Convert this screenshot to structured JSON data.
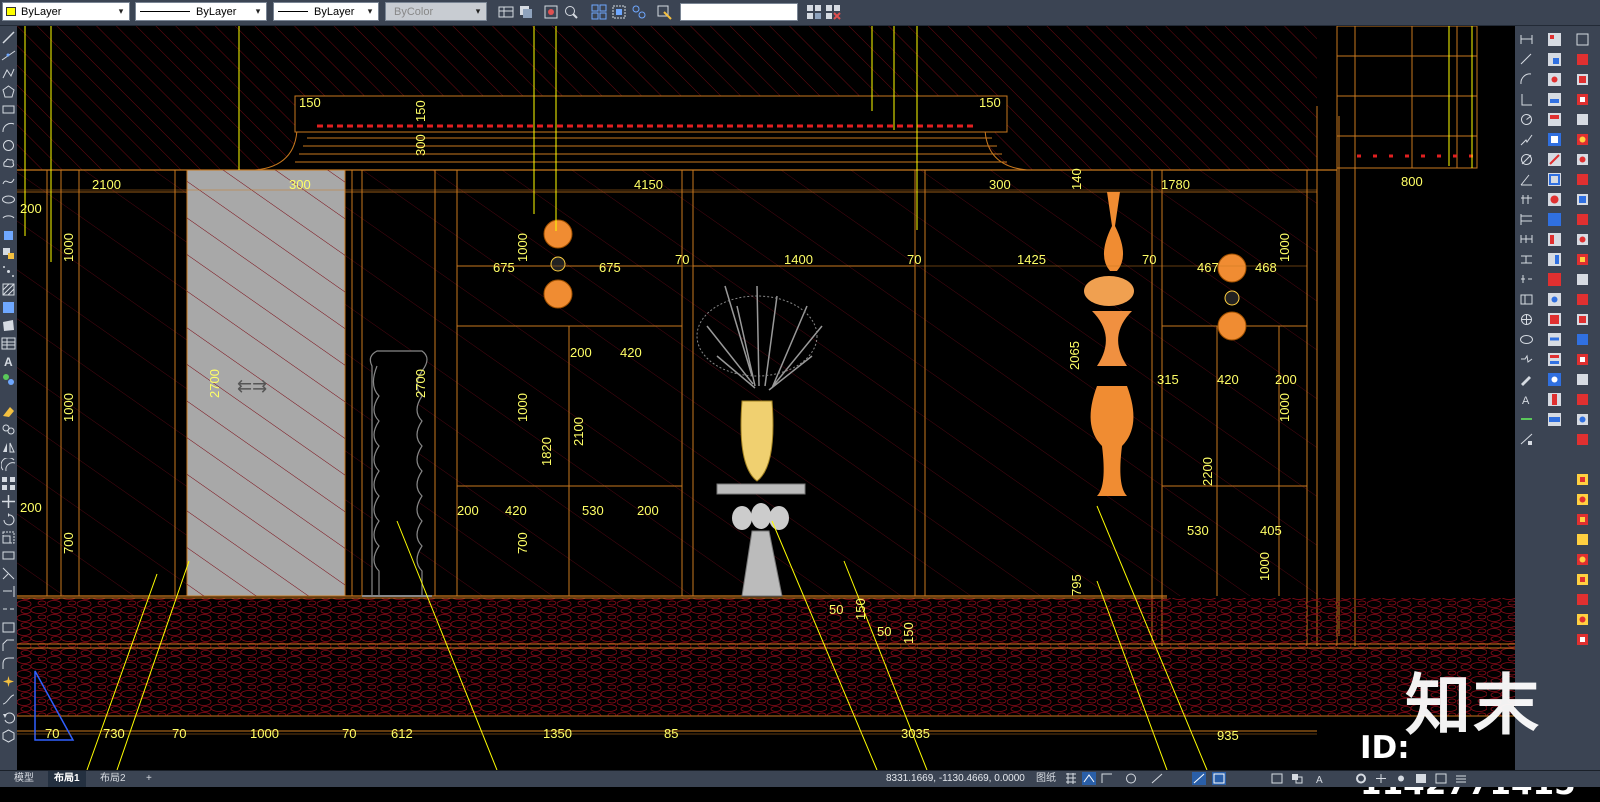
{
  "toolbar": {
    "color_dropdown": "ByLayer",
    "linetype_dropdown": "ByLayer",
    "lineweight_dropdown": "ByLayer",
    "plotstyle_dropdown": "ByColor",
    "search_value": ""
  },
  "drawing": {
    "dims": {
      "d150a": "150",
      "d150b": "150",
      "d300a": "300",
      "d150v": "150",
      "d2100": "2100",
      "d300b": "300",
      "d4150": "4150",
      "d300c": "300",
      "d140": "140",
      "d1780": "1780",
      "d800": "800",
      "d200a": "200",
      "d1000a": "1000",
      "d1000b": "1000",
      "d1000c": "1000",
      "d675a": "675",
      "d675b": "675",
      "d70a": "70",
      "d1400": "1400",
      "d70b": "70",
      "d1425": "1425",
      "d70c": "70",
      "d467": "467",
      "d468": "468",
      "d1000d": "1000",
      "d2700a": "2700",
      "d2700b": "2700",
      "d200b": "200",
      "d420a": "420",
      "d2065": "2065",
      "d315": "315",
      "d420b": "420",
      "d200c": "200",
      "d1000e": "1000",
      "d1000f": "1000",
      "d1820": "1820",
      "d2100b": "2100",
      "d1000g": "1000",
      "d2200": "2200",
      "d200d": "200",
      "d700a": "700",
      "d200e": "200",
      "d420c": "420",
      "d530a": "530",
      "d200f": "200",
      "d700b": "700",
      "d530b": "530",
      "d405": "405",
      "d1000h": "1000",
      "d795": "795",
      "d50a": "50",
      "d150c": "150",
      "d50b": "50",
      "d150d": "150",
      "d70d": "70",
      "d730": "730",
      "d70e": "70",
      "d1000i": "1000",
      "d70f": "70",
      "d612": "612",
      "d1350": "1350",
      "d85": "85",
      "d3035": "3035",
      "d935": "935"
    }
  },
  "watermark": {
    "logo_text": "知末",
    "id_text": "ID: 1142771415"
  },
  "status": {
    "tabs": [
      "模型",
      "布局1",
      "布局2"
    ],
    "add_tab": "+",
    "coordinates": "8331.1669, -1130.4669, 0.0000",
    "paper_label": "图纸"
  },
  "colors": {
    "ui_bg": "#3b4453",
    "dim_text": "#ffff66",
    "wall_line": "#c8781e",
    "hatch": "#7a0a14",
    "lamp": "#f08c32"
  }
}
